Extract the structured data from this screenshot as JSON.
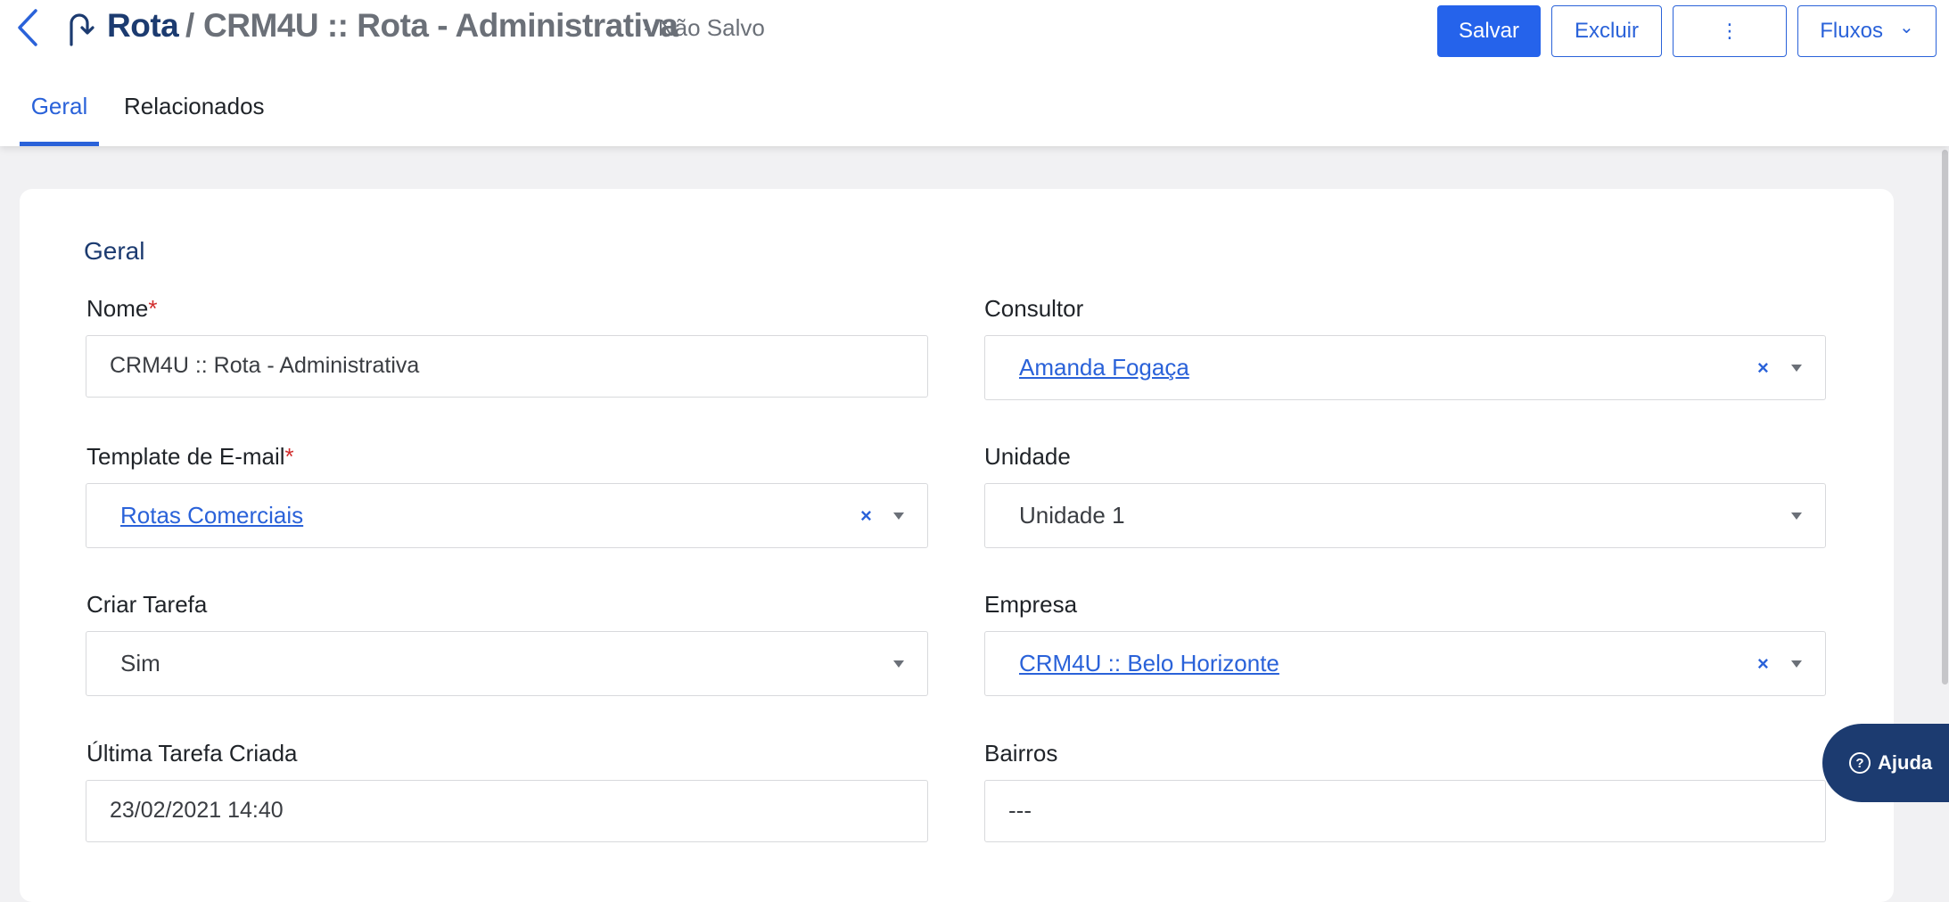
{
  "header": {
    "breadcrumb_root": "Rota",
    "breadcrumb_separator": "/",
    "record_title": "CRM4U :: Rota - Administrativa",
    "status": "- Não Salvo",
    "icons": {
      "back": "chevron-left-icon",
      "flow": "arrow-turn-icon"
    }
  },
  "toolbar": {
    "save_label": "Salvar",
    "delete_label": "Excluir",
    "more_label": "⋮",
    "flows_label": "Fluxos",
    "flows_caret": "⌄"
  },
  "tabs": [
    {
      "label": "Geral",
      "active": true
    },
    {
      "label": "Relacionados",
      "active": false
    }
  ],
  "form": {
    "section_title": "Geral",
    "required_mark": "*",
    "nome": {
      "label": "Nome",
      "value": "CRM4U :: Rota  - Administrativa",
      "required": true
    },
    "consultor": {
      "label": "Consultor",
      "value": "Amanda Fogaça"
    },
    "template_email": {
      "label": "Template de E-mail",
      "value": "Rotas Comerciais",
      "required": true
    },
    "unidade": {
      "label": "Unidade",
      "value": "Unidade 1"
    },
    "criar_tarefa": {
      "label": "Criar Tarefa",
      "value": "Sim"
    },
    "empresa": {
      "label": "Empresa",
      "value": "CRM4U :: Belo Horizonte"
    },
    "ultima_tarefa": {
      "label": "Última Tarefa Criada",
      "value": "23/02/2021 14:40"
    },
    "bairros": {
      "label": "Bairros",
      "value": "---"
    },
    "clear_symbol": "×"
  },
  "help": {
    "label": "Ajuda",
    "icon_symbol": "?"
  },
  "colors": {
    "accent": "#2563eb",
    "brand_dark": "#1c3b70",
    "required": "#d12c2c",
    "muted": "#6b7078"
  }
}
